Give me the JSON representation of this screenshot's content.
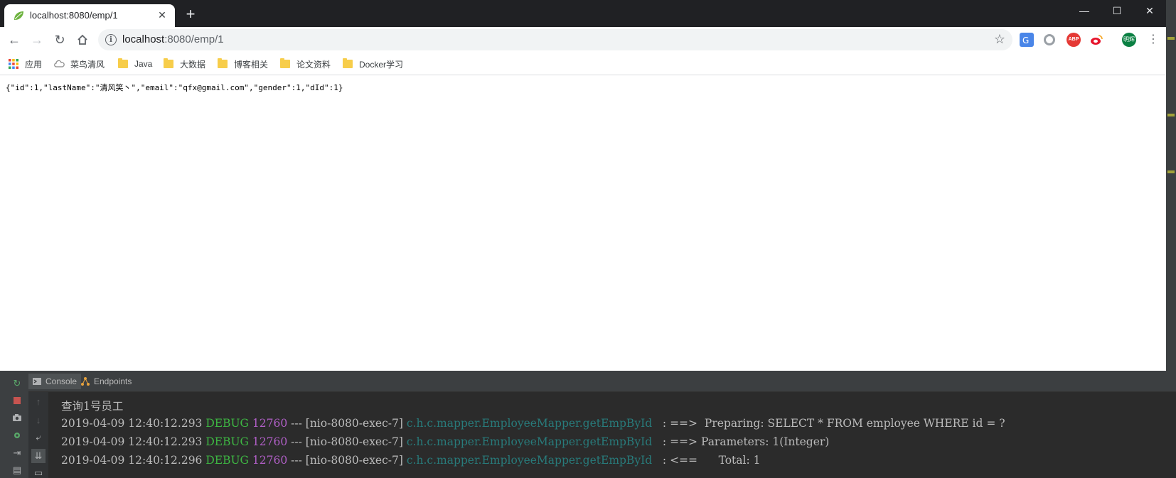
{
  "browser": {
    "tab": {
      "title": "localhost:8080/emp/1"
    },
    "window_controls": {
      "minimize": "—",
      "maximize": "☐",
      "close": "✕"
    },
    "address": {
      "host": "localhost",
      "path": ":8080/emp/1"
    },
    "bookmarks": [
      {
        "label": "应用"
      },
      {
        "label": "菜鸟清风"
      },
      {
        "label": "Java"
      },
      {
        "label": "大数据"
      },
      {
        "label": "博客相关"
      },
      {
        "label": "论文资料"
      },
      {
        "label": "Docker学习"
      }
    ],
    "extensions": {
      "abp": "ABP",
      "avatar": "明辉"
    },
    "page_content": "{\"id\":1,\"lastName\":\"清风笑丶\",\"email\":\"qfx@gmail.com\",\"gender\":1,\"dId\":1}"
  },
  "ide": {
    "tabs": [
      {
        "label": "Console",
        "active": true
      },
      {
        "label": "Endpoints",
        "active": false
      }
    ],
    "console": {
      "header": "查询1号员工",
      "lines": [
        {
          "timestamp": "2019-04-09 12:40:12.293",
          "level": "DEBUG",
          "pid": "12760",
          "sep": "---",
          "thread": "[nio-8080-exec-7]",
          "logger": "c.h.c.mapper.EmployeeMapper.getEmpById",
          "message": ": ==>  Preparing: SELECT * FROM employee WHERE id = ?"
        },
        {
          "timestamp": "2019-04-09 12:40:12.293",
          "level": "DEBUG",
          "pid": "12760",
          "sep": "---",
          "thread": "[nio-8080-exec-7]",
          "logger": "c.h.c.mapper.EmployeeMapper.getEmpById",
          "message": ": ==> Parameters: 1(Integer)"
        },
        {
          "timestamp": "2019-04-09 12:40:12.296",
          "level": "DEBUG",
          "pid": "12760",
          "sep": "---",
          "thread": "[nio-8080-exec-7]",
          "logger": "c.h.c.mapper.EmployeeMapper.getEmpById",
          "message": ": <==      Total: 1"
        }
      ]
    }
  },
  "colors": {
    "debug": "#3eb843",
    "pid": "#b05fc6",
    "logger": "#287b7b",
    "console_bg": "#2b2b2b",
    "tabstrip_bg": "#202124"
  }
}
